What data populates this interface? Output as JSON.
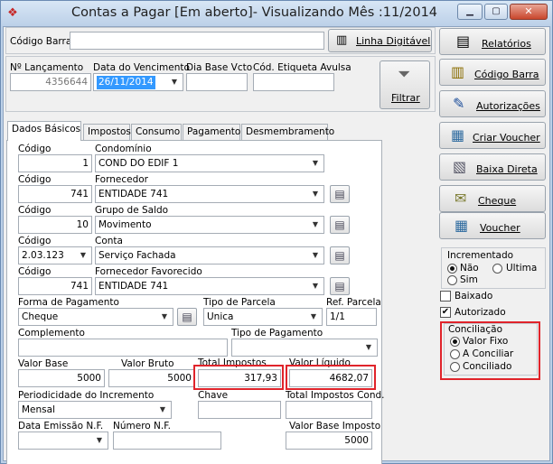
{
  "window": {
    "title": "Contas a Pagar [Em aberto]- Visualizando Mês :11/2014",
    "minimize_glyph": "▁",
    "maximize_glyph": "▢",
    "close_glyph": "✕"
  },
  "barcode": {
    "label": "Código Barra",
    "value": "",
    "button_label": "Linha Digitável"
  },
  "header": {
    "lancamento_label": "Nº Lançamento",
    "lancamento_value": "4356644",
    "vencimento_label": "Data do Vencimento",
    "vencimento_value": "26/11/2014",
    "dia_base_label": "Dia Base Vcto",
    "dia_base_value": "",
    "etiqueta_label": "Cód. Etiqueta Avulsa",
    "etiqueta_value": "",
    "filtrar_label": "Filtrar"
  },
  "tabs": [
    {
      "label": "Dados Básicos"
    },
    {
      "label": "Impostos"
    },
    {
      "label": "Consumo"
    },
    {
      "label": "Pagamento"
    },
    {
      "label": "Desmembramento"
    }
  ],
  "form": {
    "codigo_label": "Código",
    "condominio_label": "Condomínio",
    "condominio_codigo": "1",
    "condominio_nome": "COND DO EDIF 1",
    "fornecedor_label": "Fornecedor",
    "fornecedor_codigo": "741",
    "fornecedor_nome": "ENTIDADE 741",
    "grupo_saldo_label": "Grupo de Saldo",
    "grupo_saldo_codigo": "10",
    "grupo_saldo_nome": "Movimento",
    "conta_label": "Conta",
    "conta_codigo": "2.03.123",
    "conta_nome": "Serviço Fachada",
    "favorecido_label": "Fornecedor Favorecido",
    "favorecido_codigo": "741",
    "favorecido_nome": "ENTIDADE 741",
    "forma_pagamento_label": "Forma de Pagamento",
    "forma_pagamento_value": "Cheque",
    "tipo_parcela_label": "Tipo de Parcela",
    "tipo_parcela_value": "Unica",
    "ref_parcela_label": "Ref. Parcela",
    "ref_parcela_value": "1/1",
    "complemento_label": "Complemento",
    "complemento_value": "",
    "tipo_pagamento_label": "Tipo de Pagamento",
    "tipo_pagamento_value": "",
    "valor_base_label": "Valor Base",
    "valor_base_value": "5000",
    "valor_bruto_label": "Valor Bruto",
    "valor_bruto_value": "5000",
    "total_impostos_label": "Total Impostos",
    "total_impostos_value": "317,93",
    "valor_liquido_label": "Valor Líquido",
    "valor_liquido_value": "4682,07",
    "periodicidade_label": "Periodicidade do Incremento",
    "periodicidade_value": "Mensal",
    "chave_label": "Chave",
    "chave_value": "",
    "total_impostos_cond_label": "Total Impostos Cond.",
    "total_impostos_cond_value": "",
    "data_emissao_label": "Data Emissão N.F.",
    "data_emissao_value": "",
    "numero_nf_label": "Número N.F.",
    "numero_nf_value": "",
    "valor_base_imposto_label": "Valor Base Imposto",
    "valor_base_imposto_value": "5000"
  },
  "side_buttons": [
    {
      "label": "Relatórios",
      "icon": "report-icon"
    },
    {
      "label": "Código Barra",
      "icon": "barcode-icon"
    },
    {
      "label": "Autorizações",
      "icon": "authorization-pen-icon"
    },
    {
      "label": "Criar Voucher",
      "icon": "voucher-create-icon"
    },
    {
      "label": "Baixa Direta",
      "icon": "direct-payment-icon"
    },
    {
      "label": "Cheque",
      "icon": "check-icon"
    },
    {
      "label": "Voucher",
      "icon": "voucher-icon"
    }
  ],
  "incrementado": {
    "label": "Incrementado",
    "options": [
      "Não",
      "Ultima",
      "Sim"
    ],
    "selected": "Não"
  },
  "baixado": {
    "label": "Baixado",
    "checked": false
  },
  "autorizado": {
    "label": "Autorizado",
    "checked": true,
    "check_glyph": "✔"
  },
  "conciliacao": {
    "label": "Conciliação",
    "options": [
      "Valor Fixo",
      "A Conciliar",
      "Conciliado"
    ],
    "selected": "Valor Fixo"
  },
  "colors": {
    "highlight_red": "#e0242b",
    "selection_blue": "#3399ff"
  }
}
